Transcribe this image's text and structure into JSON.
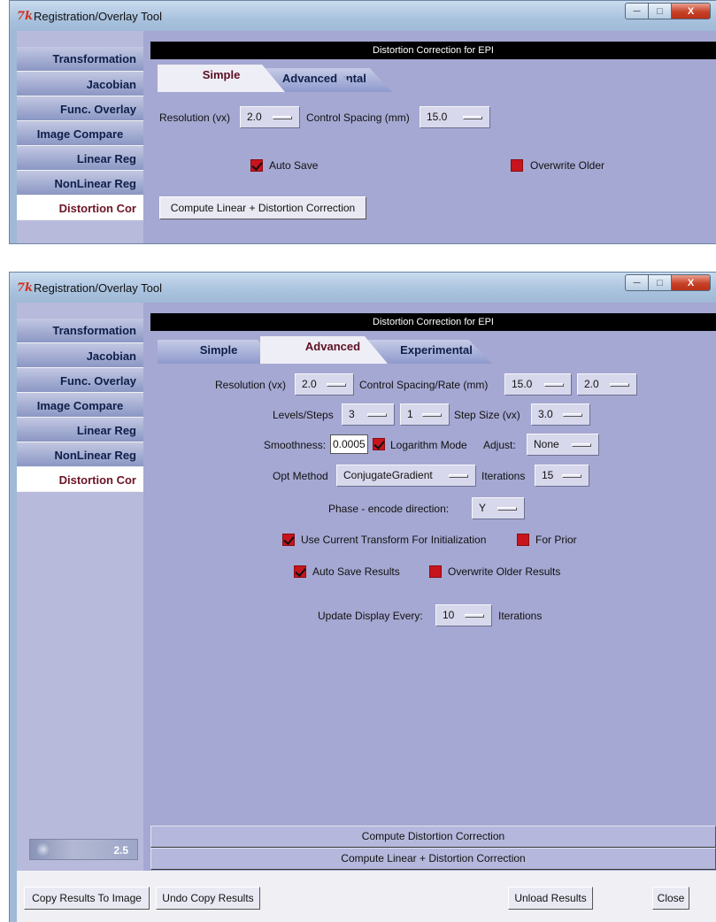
{
  "windows": [
    {
      "title": "Registration/Overlay Tool",
      "logo": "7k",
      "panel_title": "Distortion Correction for EPI",
      "sidebar": [
        "Transformation",
        "Jacobian",
        "Func. Overlay",
        "Image Compare",
        "Linear Reg",
        "NonLinear Reg",
        "Distortion Cor"
      ],
      "tabs": [
        "Simple",
        "Advanced",
        "Experimental"
      ],
      "active_tab": "Simple",
      "simple": {
        "resolution_label": "Resolution (vx)",
        "resolution_value": "2.0",
        "control_spacing_label": "Control Spacing (mm)",
        "control_spacing_value": "15.0",
        "auto_save_label": "Auto Save",
        "auto_save_checked": true,
        "overwrite_label": "Overwrite Older",
        "overwrite_checked": false,
        "compute_button": "Compute Linear + Distortion Correction"
      }
    },
    {
      "title": "Registration/Overlay Tool",
      "logo": "7k",
      "panel_title": "Distortion Correction for EPI",
      "sidebar": [
        "Transformation",
        "Jacobian",
        "Func. Overlay",
        "Image Compare",
        "Linear Reg",
        "NonLinear Reg",
        "Distortion Cor"
      ],
      "tabs": [
        "Simple",
        "Advanced",
        "Experimental"
      ],
      "active_tab": "Advanced",
      "advanced": {
        "resolution_label": "Resolution (vx)",
        "resolution_value": "2.0",
        "control_spacing_rate_label": "Control Spacing/Rate (mm)",
        "control_spacing_value": "15.0",
        "rate_value": "2.0",
        "levels_steps_label": "Levels/Steps",
        "levels_value": "3",
        "steps_value": "1",
        "step_size_label": "Step Size (vx)",
        "step_size_value": "3.0",
        "smoothness_label": "Smoothness:",
        "smoothness_value": "0.0005",
        "logarithm_label": "Logarithm Mode",
        "logarithm_checked": true,
        "adjust_label": "Adjust:",
        "adjust_value": "None",
        "opt_method_label": "Opt Method",
        "opt_method_value": "ConjugateGradient",
        "iterations_label": "Iterations",
        "iterations_value": "15",
        "phase_label": "Phase - encode direction:",
        "phase_value": "Y",
        "use_current_label": "Use Current Transform For Initialization",
        "use_current_checked": true,
        "for_prior_label": "For Prior",
        "for_prior_checked": false,
        "auto_save_label": "Auto Save Results",
        "auto_save_checked": true,
        "overwrite_label": "Overwrite Older Results",
        "overwrite_checked": false,
        "update_display_label": "Update Display Every:",
        "update_display_value": "10",
        "update_display_suffix": "Iterations",
        "compute_distortion_button": "Compute Distortion Correction",
        "compute_linear_button": "Compute Linear + Distortion Correction"
      },
      "version": "2.5",
      "bottom_buttons": {
        "copy_results": "Copy Results To Image",
        "undo_copy": "Undo Copy Results",
        "unload_results": "Unload Results",
        "close": "Close"
      }
    }
  ],
  "caption_buttons": {
    "minimize": "─",
    "maximize": "□",
    "close": "X"
  }
}
